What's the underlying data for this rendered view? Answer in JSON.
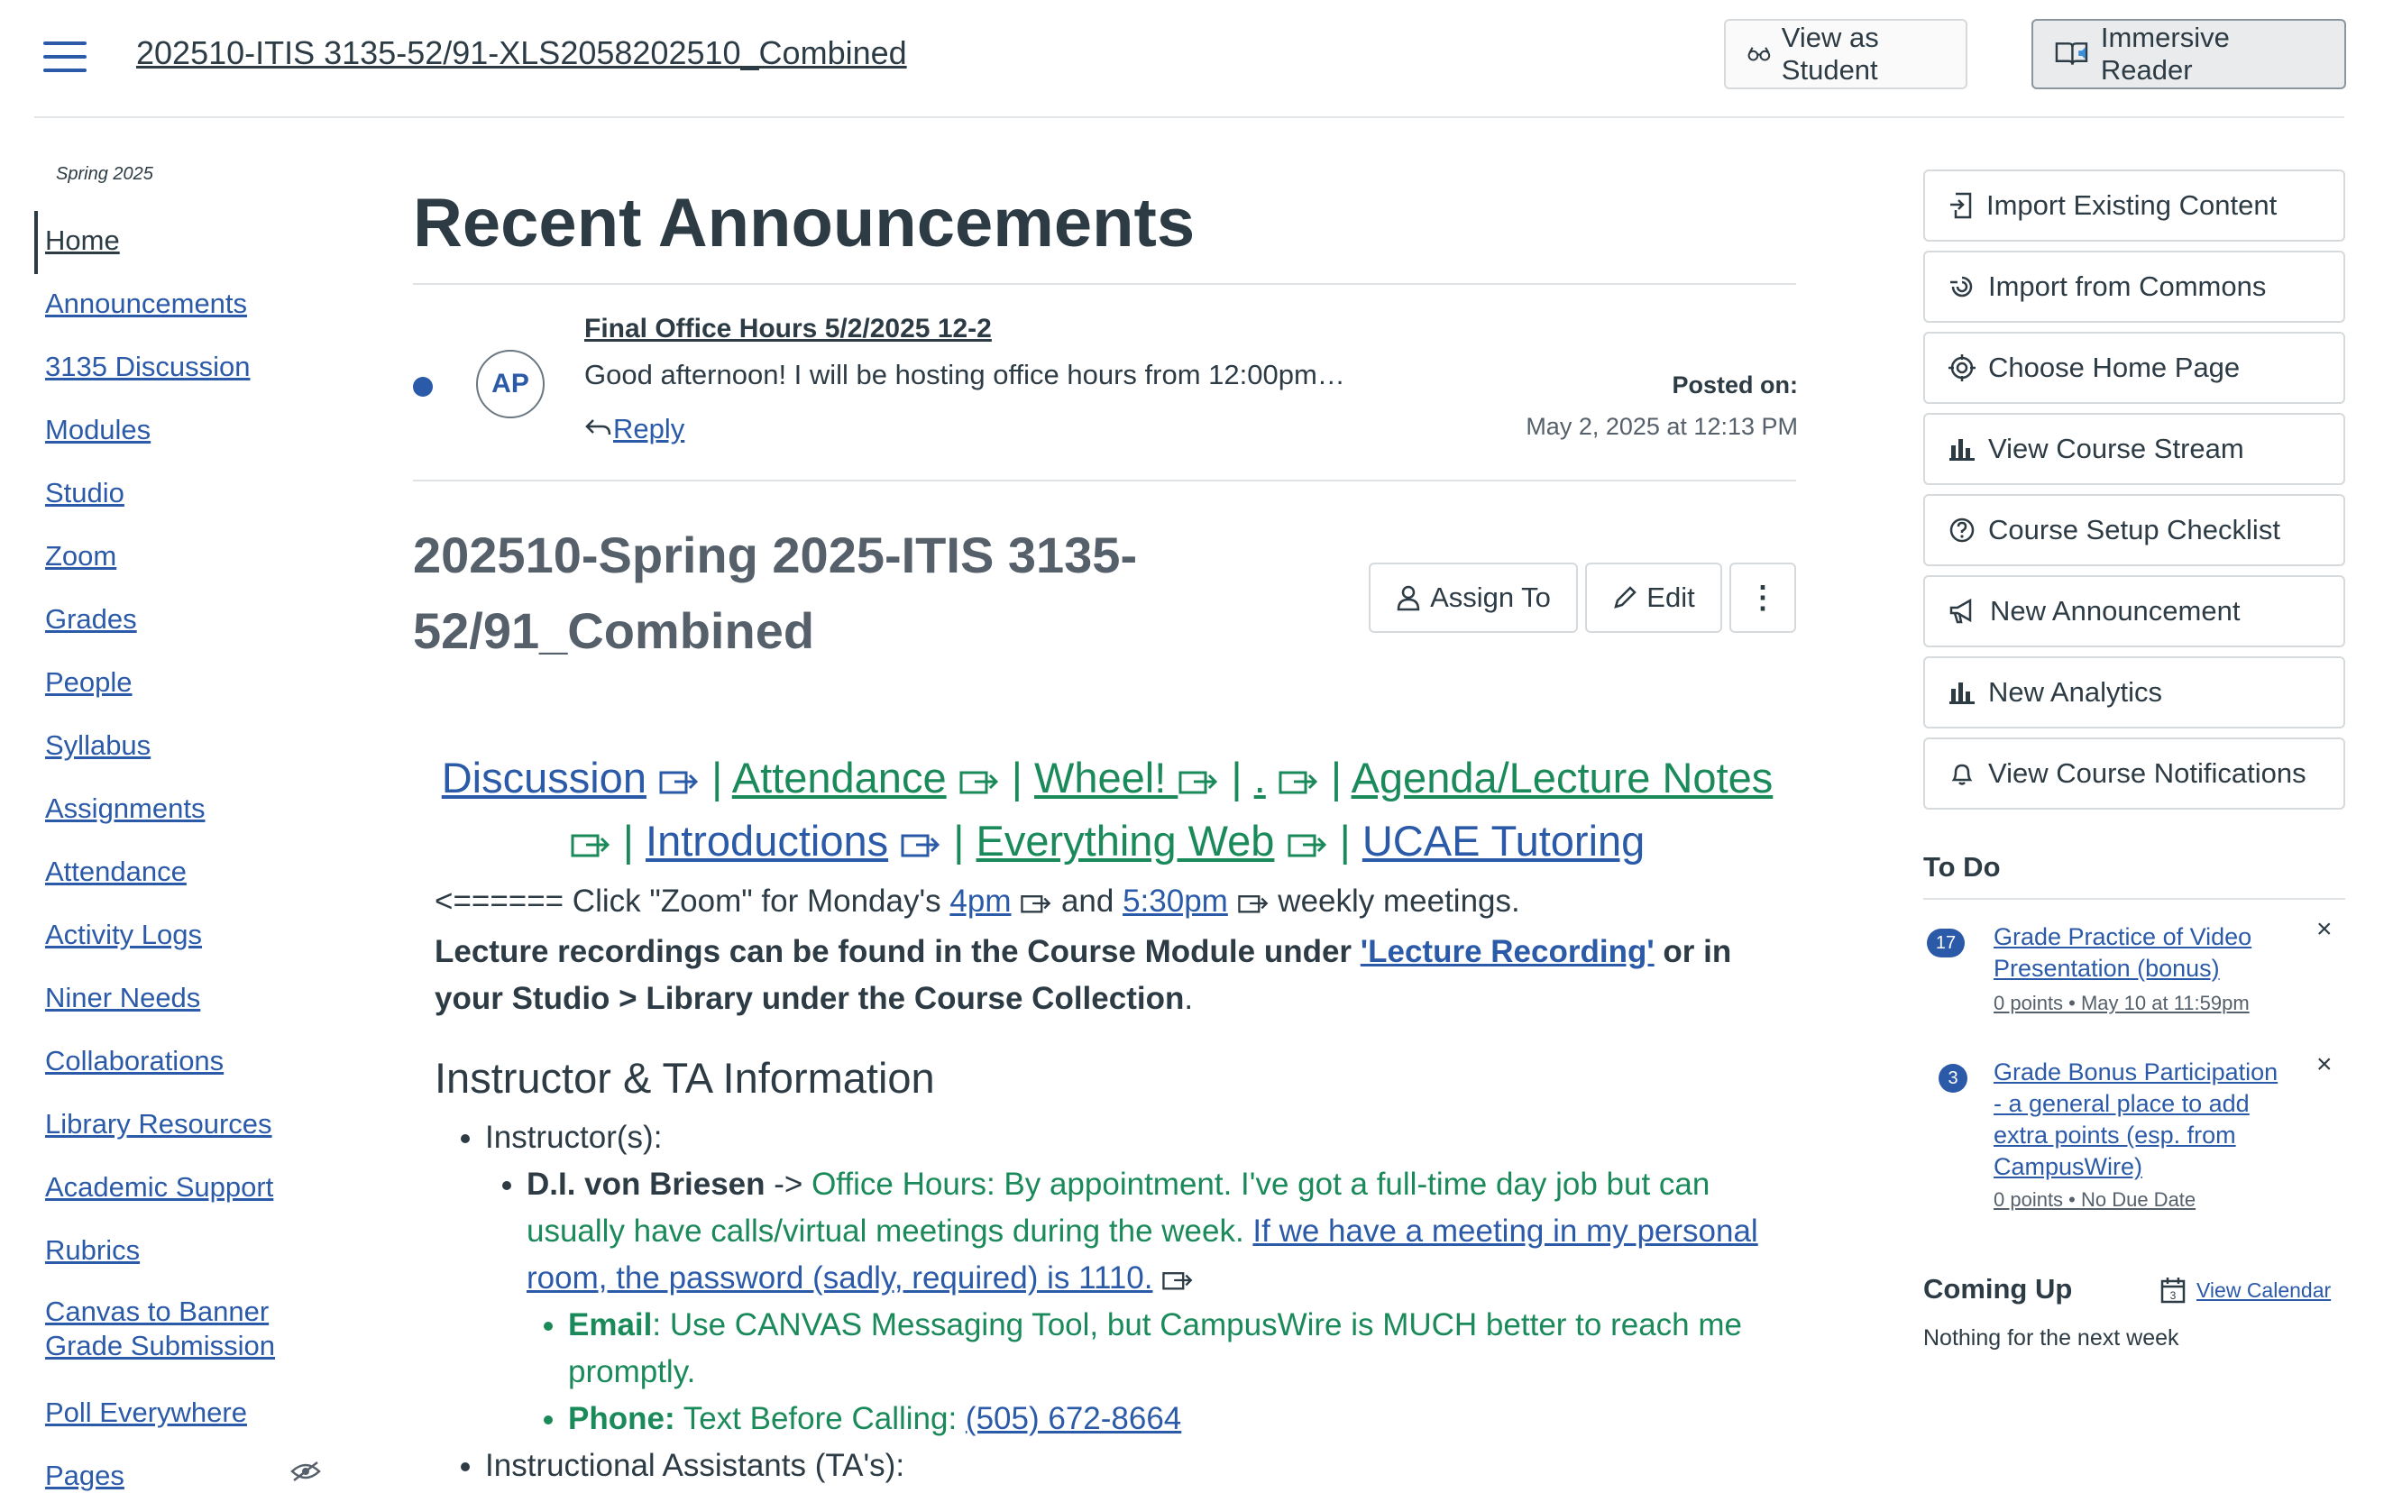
{
  "header": {
    "course_title": "202510-ITIS 3135-52/91-XLS2058202510_Combined",
    "view_as_student": "View as Student",
    "immersive_reader": "Immersive Reader"
  },
  "nav": {
    "term": "Spring 2025",
    "items": [
      {
        "label": "Home",
        "active": true
      },
      {
        "label": "Announcements"
      },
      {
        "label": "3135 Discussion"
      },
      {
        "label": "Modules"
      },
      {
        "label": "Studio"
      },
      {
        "label": "Zoom"
      },
      {
        "label": "Grades"
      },
      {
        "label": "People"
      },
      {
        "label": "Syllabus"
      },
      {
        "label": "Assignments"
      },
      {
        "label": "Attendance"
      },
      {
        "label": "Activity Logs"
      },
      {
        "label": "Niner Needs"
      },
      {
        "label": "Collaborations"
      },
      {
        "label": "Library Resources"
      },
      {
        "label": "Academic Support"
      },
      {
        "label": "Rubrics"
      },
      {
        "label": "Canvas to Banner Grade Submission"
      },
      {
        "label": "Poll Everywhere"
      },
      {
        "label": "Pages"
      }
    ]
  },
  "announcements": {
    "heading": "Recent Announcements",
    "item": {
      "avatar_initials": "AP",
      "title": "Final Office Hours 5/2/2025 12-2",
      "body": "Good afternoon!  I will be hosting office hours from 12:00pm…",
      "reply": "Reply",
      "posted_label": "Posted on:",
      "posted_date": "May 2, 2025 at 12:13 PM"
    }
  },
  "page": {
    "title": "202510-Spring 2025-ITIS 3135-52/91_Combined",
    "assign_to": "Assign To",
    "edit": "Edit",
    "more": "⋮",
    "quick_links": {
      "discussion": "Discussion",
      "attendance": "Attendance",
      "wheel": "Wheel! ",
      "dot": ".",
      "agenda": "Agenda/Lecture Notes",
      "introductions": "Introductions",
      "everything_web": "Everything Web",
      "tutoring": "UCAE Tutoring",
      "separator": "|"
    },
    "zoom_line": {
      "prefix": "<====== Click \"Zoom\" for Monday's ",
      "link1": "4pm",
      "middle": " and ",
      "link2": "5:30pm",
      "suffix": " weekly meetings."
    },
    "lecture_line": {
      "prefix": "Lecture recordings can be found in the Course Module under ",
      "link": "'Lecture Recording'",
      "suffix": " or in your Studio > Library under the Course Collection",
      "end": "."
    },
    "instructor_heading": "Instructor & TA Information",
    "instructors_label": "Instructor(s):",
    "instructor_name": "D.I. von Briesen",
    "arrow": " -> ",
    "office_hours": "Office Hours: By appointment. I've got a full-time day job but can usually have calls/virtual meetings during the week. ",
    "meeting_link": "If we have a meeting in my personal room, the password (sadly, required) is 1110.",
    "email_label": "Email",
    "email_text": ": Use CANVAS Messaging Tool, but CampusWire is MUCH better to reach me promptly.",
    "phone_label": "Phone:",
    "phone_text": " Text Before Calling: ",
    "phone_number": "(505) 672-8664",
    "tas_label": "Instructional Assistants (TA's):"
  },
  "sidebar": {
    "buttons": [
      {
        "label": "Import Existing Content",
        "icon": "import-icon"
      },
      {
        "label": "Import from Commons",
        "icon": "commons-icon"
      },
      {
        "label": "Choose Home Page",
        "icon": "target-icon"
      },
      {
        "label": "View Course Stream",
        "icon": "bar-chart-icon"
      },
      {
        "label": "Course Setup Checklist",
        "icon": "question-icon"
      },
      {
        "label": "New Announcement",
        "icon": "megaphone-icon"
      },
      {
        "label": "New Analytics",
        "icon": "bar-chart-icon"
      },
      {
        "label": "View Course Notifications",
        "icon": "bell-icon"
      }
    ],
    "todo": {
      "heading": "To Do",
      "items": [
        {
          "badge": "17",
          "title": "Grade Practice of Video Presentation (bonus)",
          "meta": "0 points • May 10 at 11:59pm"
        },
        {
          "badge": "3",
          "title": "Grade Bonus Participation - a general place to add extra points (esp. from CampusWire)",
          "meta": "0 points • No Due Date"
        }
      ],
      "dismiss": "×"
    },
    "coming_up": {
      "heading": "Coming Up",
      "view_calendar": "View Calendar",
      "calendar_day": "3",
      "empty": "Nothing for the next week"
    }
  },
  "colors": {
    "link": "#2b5aa8",
    "green_text": "#1b8a5a",
    "text": "#2d3b45"
  }
}
